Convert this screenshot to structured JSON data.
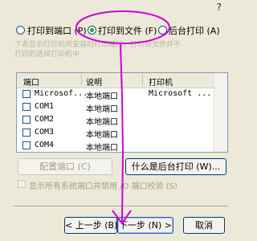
{
  "title_bar": {
    "mark": "?"
  },
  "radios": [
    {
      "label": "打印到端口 (P)",
      "selected": false
    },
    {
      "label": "打印到文件 (F)",
      "selected": true
    },
    {
      "label": "后台打印 (A)",
      "selected": false
    }
  ],
  "description": [
    "下表显示打印机所安装的打印端口。打印到文件并不",
    "打印的选择打印机中"
  ],
  "port_list": {
    "columns": [
      "端口",
      "说明",
      "打印机"
    ],
    "rows": [
      {
        "port": "Microsof...",
        "desc": "本地端口",
        "printer": "Microsoft ..."
      },
      {
        "port": "COM1",
        "desc": "本地端口",
        "printer": ""
      },
      {
        "port": "COM2",
        "desc": "本地端口",
        "printer": ""
      },
      {
        "port": "COM3",
        "desc": "本地端口",
        "printer": ""
      },
      {
        "port": "COM4",
        "desc": "本地端口",
        "printer": ""
      }
    ]
  },
  "buttons": {
    "configure_port": "配置端口 (C)",
    "what_is_background": "什么是后台打印 (W)...",
    "back": "< 上一步 (B)",
    "next": "下一步 (N) >",
    "cancel": "取消"
  },
  "show_all_ports": "显示所有系统端口并禁用 /O 端口校验 (S)",
  "annotation_color": "#d000d8"
}
